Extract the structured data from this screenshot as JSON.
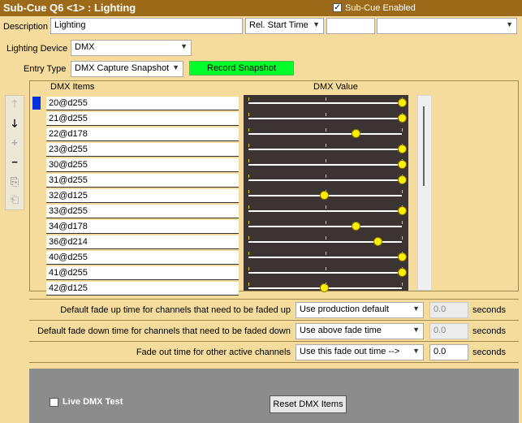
{
  "title": "Sub-Cue Q6 <1> : Lighting",
  "subcue_enabled": {
    "label": "Sub-Cue Enabled",
    "checked": true
  },
  "description": {
    "label": "Description",
    "value": "Lighting"
  },
  "start_time": {
    "selected": "Rel. Start Time",
    "value": "",
    "extra_selected": ""
  },
  "lighting_device": {
    "label": "Lighting Device",
    "selected": "DMX"
  },
  "entry_type": {
    "label": "Entry Type",
    "selected": "DMX Capture Snapshot"
  },
  "record_button": "Record Snapshot",
  "columns": {
    "items": "DMX Items",
    "value": "DMX Value"
  },
  "dmx_items": [
    {
      "label": "20@d255",
      "value": 255
    },
    {
      "label": "21@d255",
      "value": 255
    },
    {
      "label": "22@d178",
      "value": 178
    },
    {
      "label": "23@d255",
      "value": 255
    },
    {
      "label": "30@d255",
      "value": 255
    },
    {
      "label": "31@d255",
      "value": 255
    },
    {
      "label": "32@d125",
      "value": 125
    },
    {
      "label": "33@d255",
      "value": 255
    },
    {
      "label": "34@d178",
      "value": 178
    },
    {
      "label": "36@d214",
      "value": 214
    },
    {
      "label": "40@d255",
      "value": 255
    },
    {
      "label": "41@d255",
      "value": 255
    },
    {
      "label": "42@d125",
      "value": 125
    }
  ],
  "dmx_max": 255,
  "fade_settings": [
    {
      "label": "Default fade up time for channels that need to be faded up",
      "selected": "Use production default",
      "value": "0.0",
      "enabled": false,
      "unit": "seconds"
    },
    {
      "label": "Default fade down time for channels that need to be faded down",
      "selected": "Use above fade time",
      "value": "0.0",
      "enabled": false,
      "unit": "seconds"
    },
    {
      "label": "Fade out time for other active channels",
      "selected": "Use this fade out time -->",
      "value": "0.0",
      "enabled": true,
      "unit": "seconds"
    }
  ],
  "live_dmx_test": {
    "label": "Live DMX Test",
    "checked": false
  },
  "reset_button": "Reset DMX Items",
  "icons": [
    "move-up-icon",
    "move-down-icon",
    "add-icon",
    "remove-icon",
    "copy-icon",
    "paste-icon",
    "chevron-down-icon"
  ],
  "colors": {
    "titlebar": "#9c6a18",
    "background": "#f5dc9c",
    "record": "#00ff2a",
    "knob": "#ffee00",
    "slider_bg": "#3c3433"
  }
}
